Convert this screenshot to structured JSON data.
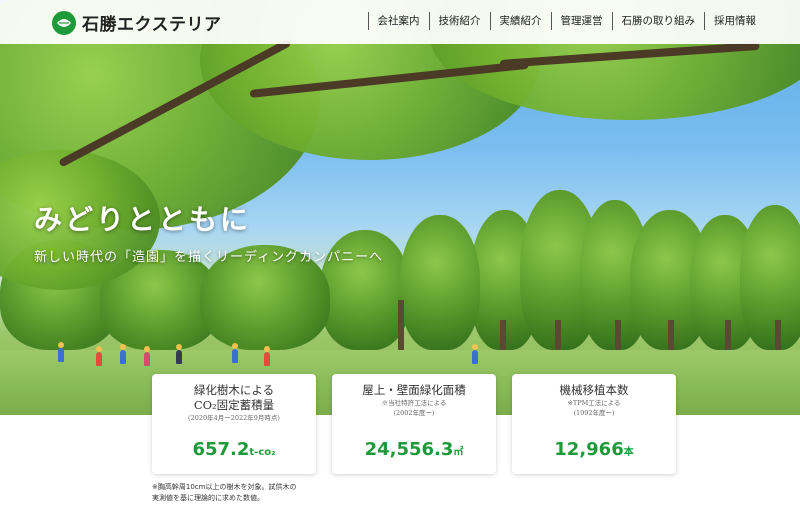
{
  "header": {
    "logo_text": "石勝エクステリア",
    "nav": [
      "会社案内",
      "技術紹介",
      "実績紹介",
      "管理運営",
      "石勝の取り組み",
      "採用情報"
    ]
  },
  "hero": {
    "title": "みどりとともに",
    "subtitle": "新しい時代の「造園」を描くリーディングカンパニーへ"
  },
  "cards": [
    {
      "heading_line1": "緑化樹木による",
      "heading_line2": "CO₂固定蓄積量",
      "note1": "(2020年4月ー2022年9月時点)",
      "note2": "",
      "value": "657.2",
      "unit": "t-co₂"
    },
    {
      "heading_line1": "屋上・壁面緑化面積",
      "heading_line2": "",
      "note1": "※当社特許工法による",
      "note2": "(2002年度ー)",
      "value": "24,556.3",
      "unit": "㎡"
    },
    {
      "heading_line1": "機械移植本数",
      "heading_line2": "",
      "note1": "※TPM工法による",
      "note2": "(1992年度ー)",
      "value": "12,966",
      "unit": "本"
    }
  ],
  "footnote": {
    "line1": "※胸高幹周10cm以上の樹木を対象。試供木の",
    "line2": "実測値を基に理論的に求めた数値。"
  }
}
